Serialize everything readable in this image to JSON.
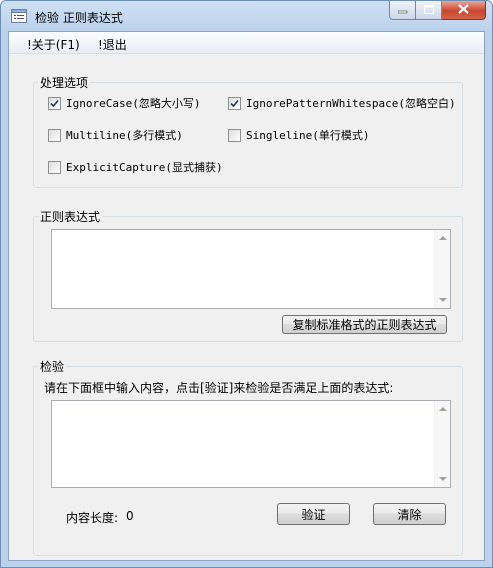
{
  "window": {
    "title": "检验 正则表达式",
    "icon": "form-icon",
    "buttons": [
      "minimize-icon",
      "maximize-icon",
      "close-icon"
    ]
  },
  "menu": {
    "items": [
      {
        "label": "!关于(F1)"
      },
      {
        "label": "!退出"
      }
    ]
  },
  "options": {
    "title": "处理选项",
    "items": [
      {
        "label": "IgnoreCase(忽略大小写)",
        "checked": true
      },
      {
        "label": "IgnorePatternWhitespace(忽略空白)",
        "checked": true
      },
      {
        "label": "Multiline(多行模式)",
        "checked": false
      },
      {
        "label": "Singleline(单行模式)",
        "checked": false
      },
      {
        "label": "ExplicitCapture(显式捕获)",
        "checked": false
      }
    ]
  },
  "regex": {
    "title": "正则表达式",
    "value": "",
    "copy_button": "复制标准格式的正则表达式"
  },
  "test": {
    "title": "检验",
    "instruction": "请在下面框中输入内容，点击[验证]来检验是否满足上面的表达式:",
    "value": "",
    "length_label": "内容长度:",
    "length_value": "0",
    "verify_button": "验证",
    "clear_button": "清除"
  },
  "colors": {
    "title_bar": "#bcd2ec",
    "close_button": "#c9462c",
    "client_bg": "#f0f0f0"
  }
}
